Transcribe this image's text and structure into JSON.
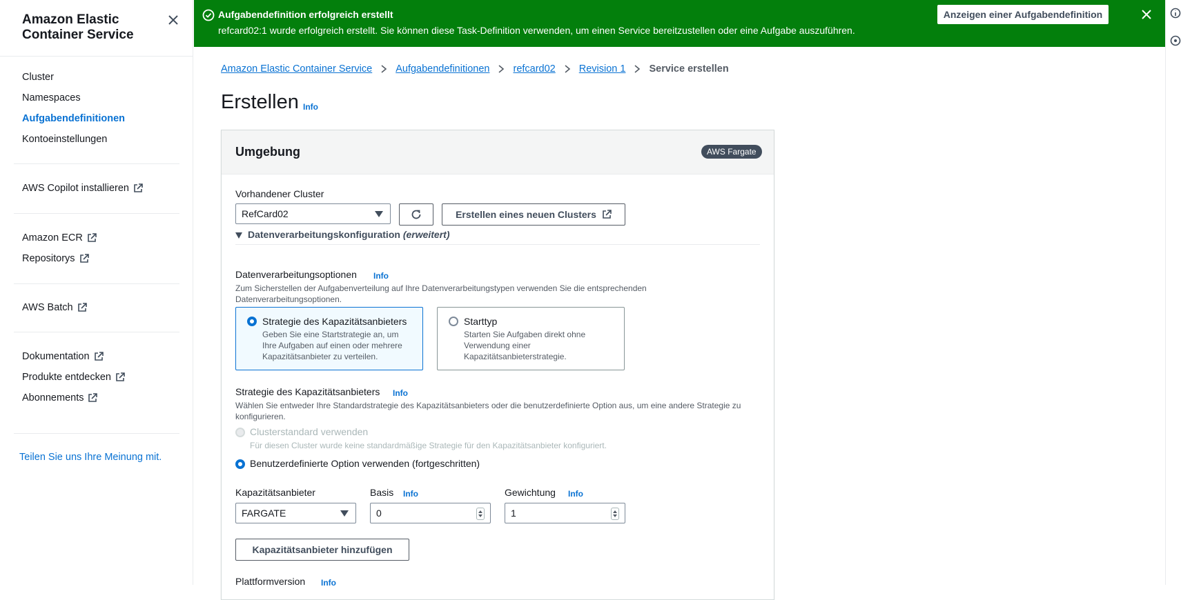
{
  "sidebar": {
    "title": "Amazon Elastic Container Service",
    "nav": [
      {
        "label": "Cluster"
      },
      {
        "label": "Namespaces"
      },
      {
        "label": "Aufgabendefinitionen",
        "active": true
      },
      {
        "label": "Kontoeinstellungen"
      }
    ],
    "copilot": "AWS Copilot installieren",
    "ecr": "Amazon ECR",
    "repos": "Repositorys",
    "batch": "AWS Batch",
    "docs": "Dokumentation",
    "discover": "Produkte entdecken",
    "subscriptions": "Abonnements",
    "feedback": "Teilen Sie uns Ihre Meinung mit."
  },
  "banner": {
    "title": "Aufgabendefinition erfolgreich erstellt",
    "text": "refcard02:1 wurde erfolgreich erstellt. Sie können diese Task-Definition verwenden, um einen Service bereitzustellen oder eine Aufgabe auszuführen.",
    "button": "Anzeigen einer Aufgabendefinition",
    "color": "#037f0c"
  },
  "breadcrumb": {
    "items": [
      "Amazon Elastic Container Service",
      "Aufgabendefinitionen",
      "refcard02",
      "Revision 1"
    ],
    "current": "Service erstellen"
  },
  "page": {
    "title": "Erstellen",
    "info": "Info"
  },
  "env": {
    "title": "Umgebung",
    "badge": "AWS Fargate",
    "cluster_label": "Vorhandener Cluster",
    "cluster_value": "RefCard02",
    "new_cluster_button": "Erstellen eines neuen Clusters",
    "compute_config": "Datenverarbeitungskonfiguration",
    "compute_config_suffix": "(erweitert)",
    "compute_options_label": "Datenverarbeitungsoptionen",
    "compute_options_desc": "Zum Sicherstellen der Aufgabenverteilung auf Ihre Datenverarbeitungstypen verwenden Sie die entsprechenden Datenverarbeitungsoptionen.",
    "tile_capacity_title": "Strategie des Kapazitätsanbieters",
    "tile_capacity_desc": "Geben Sie eine Startstrategie an, um Ihre Aufgaben auf einen oder mehrere Kapazitätsanbieter zu verteilen.",
    "tile_launch_title": "Starttyp",
    "tile_launch_desc": "Starten Sie Aufgaben direkt ohne Verwendung einer Kapazitätsanbieterstrategie.",
    "strategy_label": "Strategie des Kapazitätsanbieters",
    "strategy_desc": "Wählen Sie entweder Ihre Standardstrategie des Kapazitätsanbieters oder die benutzerdefinierte Option aus, um eine andere Strategie zu konfigurieren.",
    "default_option": "Clusterstandard verwenden",
    "default_option_desc": "Für diesen Cluster wurde keine standardmäßige Strategie für den Kapazitätsanbieter konfiguriert.",
    "custom_option": "Benutzerdefinierte Option verwenden (fortgeschritten)",
    "provider_label": "Kapazitätsanbieter",
    "provider_value": "FARGATE",
    "base_label": "Basis",
    "base_value": "0",
    "weight_label": "Gewichtung",
    "weight_value": "1",
    "add_provider_button": "Kapazitätsanbieter hinzufügen",
    "platform_label": "Plattformversion",
    "info": "Info"
  }
}
